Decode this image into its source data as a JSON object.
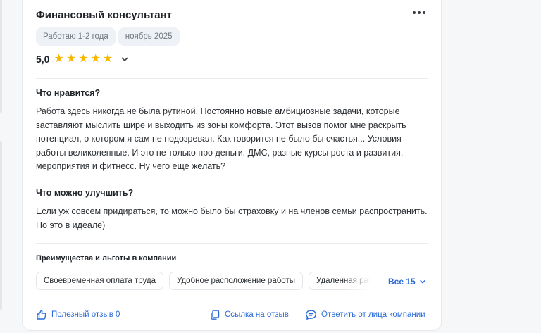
{
  "review": {
    "title": "Финансовый консультант",
    "tags": [
      "Работаю 1-2 года",
      "ноябрь 2025"
    ],
    "rating": "5,0",
    "stars": 5,
    "pros_title": "Что нравится?",
    "pros_text": "Работа здесь никогда не была рутиной. Постоянно новые амбициозные задачи, которые заставляют мыслить шире и выходить из зоны комфорта. Этот вызов помог мне раскрыть потенциал, о котором я сам не подозревал. Как говорится не было бы счастья... Условия работы великолепные. И это не только про деньги. ДМС, разные курсы роста и развития, мероприятия и фитнесс. Ну чего еще желать?",
    "cons_title": "Что можно улучшить?",
    "cons_text": "Если уж совсем придираться, то можно было бы страховку и на членов семьи распространить. Но это в идеале)"
  },
  "benefits": {
    "title": "Преимущества и льготы в компании",
    "items": [
      "Своевременная оплата труда",
      "Удобное расположение работы",
      "Удаленная работа"
    ],
    "all_label": "Все 15"
  },
  "actions": {
    "helpful": "Полезный отзыв 0",
    "link": "Ссылка на отзыв",
    "reply": "Ответить от лица компании"
  },
  "colors": {
    "accent": "#2a6ad8",
    "star": "#f5b700",
    "tag_bg": "#eef1f5"
  },
  "icons": [
    "more-icon",
    "star-icon",
    "chevron-down-icon",
    "thumbs-up-icon",
    "copy-link-icon",
    "comment-icon"
  ]
}
